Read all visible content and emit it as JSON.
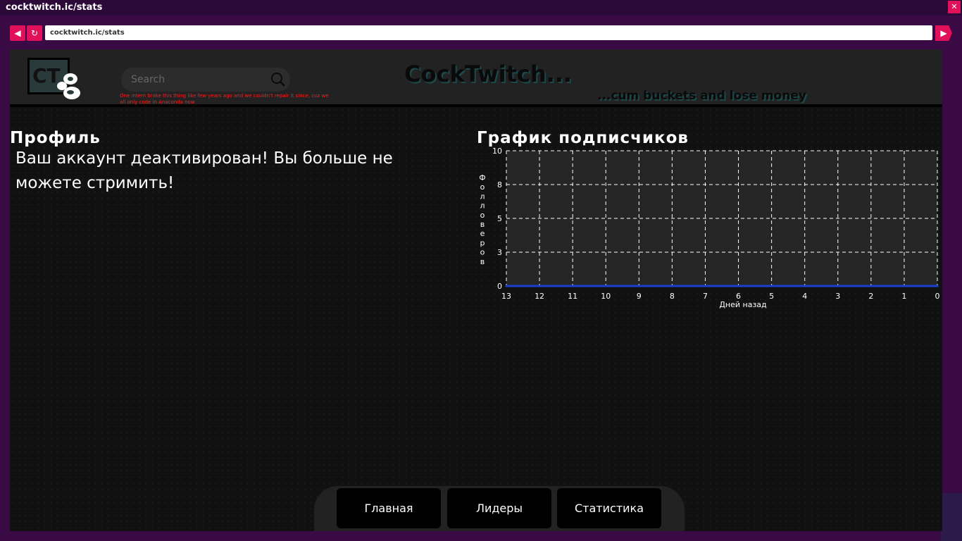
{
  "window": {
    "title": "cocktwitch.ic/stats",
    "close_label": "✕"
  },
  "browser": {
    "back_icon": "◀",
    "reload_icon": "↻",
    "go_icon": "▶",
    "url": "cocktwitch.ic/stats"
  },
  "header": {
    "logo_text": "CT",
    "search_placeholder": "Search",
    "intern_note": "One intern broke this thing like few years ago and we couldn't repair it since, cuz we all only code in Anaconda now",
    "site_title": "CockTwitch...",
    "tagline": "...cum buckets and lose money"
  },
  "profile": {
    "heading": "Профиль",
    "message": "Ваш аккаунт деактивирован! Вы больше не можете стримить!"
  },
  "chart": {
    "heading": "График подписчиков"
  },
  "chart_data": {
    "type": "line",
    "title": "",
    "xlabel": "Дней назад",
    "ylabel": "Фолловеров",
    "x": [
      13,
      12,
      11,
      10,
      9,
      8,
      7,
      6,
      5,
      4,
      3,
      2,
      1,
      0
    ],
    "x_ticks": [
      "13",
      "12",
      "11",
      "10",
      "9",
      "8",
      "7",
      "6",
      "5",
      "4",
      "3",
      "2",
      "1",
      "0"
    ],
    "y_ticks": [
      "0",
      "3",
      "5",
      "8",
      "10"
    ],
    "ylim": [
      0,
      10
    ],
    "grid": true,
    "series": [
      {
        "values": [
          0,
          0,
          0,
          0,
          0,
          0,
          0,
          0,
          0,
          0,
          0,
          0,
          0,
          0
        ],
        "color": "#1a3fd1"
      }
    ]
  },
  "bottom_nav": {
    "items": [
      {
        "label": "Главная"
      },
      {
        "label": "Лидеры"
      },
      {
        "label": "Статистика"
      }
    ]
  },
  "colors": {
    "accent": "#e0105a",
    "page_bg": "#111111",
    "header_bg": "#222222",
    "chart_bg": "#262626",
    "series": "#1a3fd1",
    "error_text": "#ff1c1c"
  }
}
